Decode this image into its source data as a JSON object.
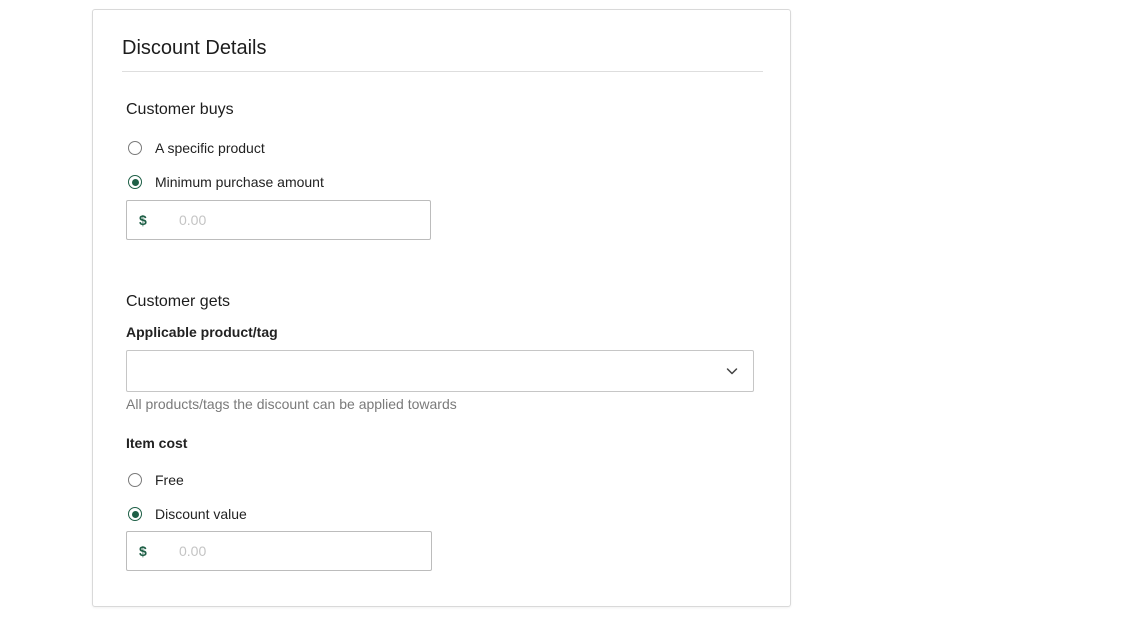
{
  "card": {
    "title": "Discount Details"
  },
  "customer_buys": {
    "title": "Customer buys",
    "options": [
      {
        "label": "A specific product",
        "checked": false
      },
      {
        "label": "Minimum purchase amount",
        "checked": true
      }
    ],
    "amount": {
      "currency": "$",
      "placeholder": "0.00",
      "value": ""
    }
  },
  "customer_gets": {
    "title": "Customer gets",
    "applicable_label": "Applicable product/tag",
    "applicable_value": "",
    "applicable_helper": "All products/tags the discount can be applied towards",
    "item_cost_label": "Item cost",
    "options": [
      {
        "label": "Free",
        "checked": false
      },
      {
        "label": "Discount value",
        "checked": true
      }
    ],
    "amount": {
      "currency": "$",
      "placeholder": "0.00",
      "value": ""
    }
  },
  "colors": {
    "accent": "#1e5f46",
    "border": "#d9d9d9",
    "helper_text": "#7a7a7a"
  },
  "icons": {
    "select_chevron": "chevron-down-icon"
  }
}
